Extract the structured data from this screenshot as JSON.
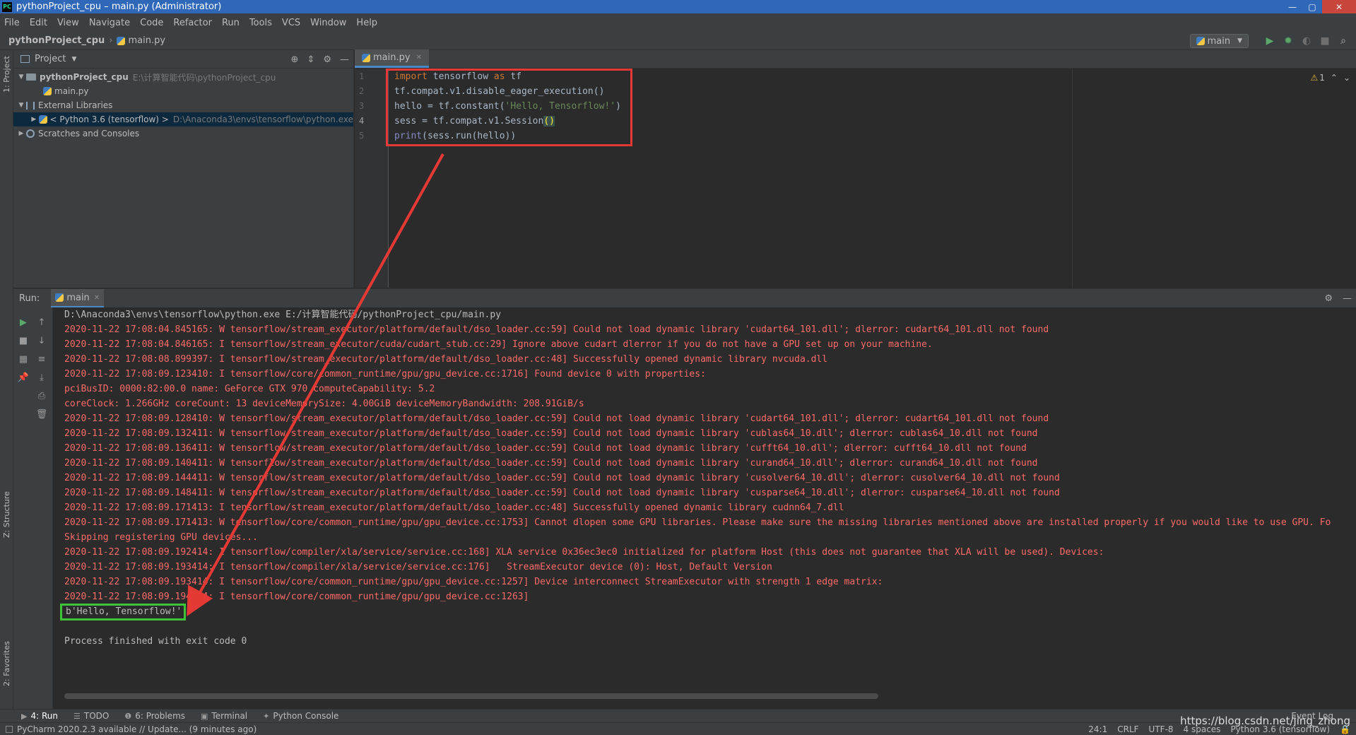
{
  "window": {
    "title": "pythonProject_cpu – main.py (Administrator)",
    "app_icon_text": "PC",
    "minimize": "—",
    "maximize": "▢",
    "close": "✕"
  },
  "menu": [
    "File",
    "Edit",
    "View",
    "Navigate",
    "Code",
    "Refactor",
    "Run",
    "Tools",
    "VCS",
    "Window",
    "Help"
  ],
  "navbar": {
    "project": "pythonProject_cpu",
    "separator": "›",
    "file": "main.py",
    "run_config": "main"
  },
  "left_stripe": {
    "project_label": "1: Project",
    "structure_label": "Z: Structure",
    "favorites_label": "2: Favorites"
  },
  "project_panel": {
    "title": "Project",
    "tree": [
      {
        "label": "pythonProject_cpu",
        "detail": "E:\\计算智能代码\\pythonProject_cpu"
      },
      {
        "label": "main.py",
        "detail": ""
      },
      {
        "label": "External Libraries",
        "detail": ""
      },
      {
        "label": "< Python 3.6 (tensorflow) >",
        "detail": "D:\\Anaconda3\\envs\\tensorflow\\python.exe"
      },
      {
        "label": "Scratches and Consoles",
        "detail": ""
      }
    ]
  },
  "editor": {
    "tab_label": "main.py",
    "line_numbers": [
      "1",
      "2",
      "3",
      "4",
      "5"
    ],
    "inspection": {
      "warning_count": "1"
    },
    "code": {
      "l1_kw": "import",
      "l1_rest": " tensorflow ",
      "l1_as": "as",
      "l1_alias": " tf",
      "l2": "tf.compat.v1.disable_eager_execution()",
      "l3_pre": "hello = tf.constant(",
      "l3_str": "'Hello, Tensorflow!'",
      "l3_post": ")",
      "l4_pre": "sess = tf.compat.v1.Session",
      "l4_paren": "()",
      "l5_fn": "print",
      "l5_rest": "(sess.run(hello))"
    }
  },
  "run_panel": {
    "label": "Run:",
    "tab_label": "main",
    "command": "D:\\Anaconda3\\envs\\tensorflow\\python.exe E:/计算智能代码/pythonProject_cpu/main.py",
    "log_lines": [
      "2020-11-22 17:08:04.845165: W tensorflow/stream_executor/platform/default/dso_loader.cc:59] Could not load dynamic library 'cudart64_101.dll'; dlerror: cudart64_101.dll not found",
      "2020-11-22 17:08:04.846165: I tensorflow/stream_executor/cuda/cudart_stub.cc:29] Ignore above cudart dlerror if you do not have a GPU set up on your machine.",
      "2020-11-22 17:08:08.899397: I tensorflow/stream_executor/platform/default/dso_loader.cc:48] Successfully opened dynamic library nvcuda.dll",
      "2020-11-22 17:08:09.123410: I tensorflow/core/common_runtime/gpu/gpu_device.cc:1716] Found device 0 with properties:",
      "pciBusID: 0000:82:00.0 name: GeForce GTX 970 computeCapability: 5.2",
      "coreClock: 1.266GHz coreCount: 13 deviceMemorySize: 4.00GiB deviceMemoryBandwidth: 208.91GiB/s",
      "2020-11-22 17:08:09.128410: W tensorflow/stream_executor/platform/default/dso_loader.cc:59] Could not load dynamic library 'cudart64_101.dll'; dlerror: cudart64_101.dll not found",
      "2020-11-22 17:08:09.132411: W tensorflow/stream_executor/platform/default/dso_loader.cc:59] Could not load dynamic library 'cublas64_10.dll'; dlerror: cublas64_10.dll not found",
      "2020-11-22 17:08:09.136411: W tensorflow/stream_executor/platform/default/dso_loader.cc:59] Could not load dynamic library 'cufft64_10.dll'; dlerror: cufft64_10.dll not found",
      "2020-11-22 17:08:09.140411: W tensorflow/stream_executor/platform/default/dso_loader.cc:59] Could not load dynamic library 'curand64_10.dll'; dlerror: curand64_10.dll not found",
      "2020-11-22 17:08:09.144411: W tensorflow/stream_executor/platform/default/dso_loader.cc:59] Could not load dynamic library 'cusolver64_10.dll'; dlerror: cusolver64_10.dll not found",
      "2020-11-22 17:08:09.148411: W tensorflow/stream_executor/platform/default/dso_loader.cc:59] Could not load dynamic library 'cusparse64_10.dll'; dlerror: cusparse64_10.dll not found",
      "2020-11-22 17:08:09.171413: I tensorflow/stream_executor/platform/default/dso_loader.cc:48] Successfully opened dynamic library cudnn64_7.dll",
      "2020-11-22 17:08:09.171413: W tensorflow/core/common_runtime/gpu/gpu_device.cc:1753] Cannot dlopen some GPU libraries. Please make sure the missing libraries mentioned above are installed properly if you would like to use GPU. Fo",
      "Skipping registering GPU devices...",
      "2020-11-22 17:08:09.192414: I tensorflow/compiler/xla/service/service.cc:168] XLA service 0x36ec3ec0 initialized for platform Host (this does not guarantee that XLA will be used). Devices:",
      "2020-11-22 17:08:09.193414: I tensorflow/compiler/xla/service/service.cc:176]   StreamExecutor device (0): Host, Default Version",
      "2020-11-22 17:08:09.193414: I tensorflow/core/common_runtime/gpu/gpu_device.cc:1257] Device interconnect StreamExecutor with strength 1 edge matrix:",
      "2020-11-22 17:08:09.194414: I tensorflow/core/common_runtime/gpu/gpu_device.cc:1263]"
    ],
    "result": "b'Hello, Tensorflow!'",
    "exit": "Process finished with exit code 0"
  },
  "bottom_tools": [
    {
      "icon": "▶",
      "label": "4: Run"
    },
    {
      "icon": "☰",
      "label": "TODO"
    },
    {
      "icon": "❶",
      "label": "6: Problems"
    },
    {
      "icon": "▣",
      "label": "Terminal"
    },
    {
      "icon": "✦",
      "label": "Python Console"
    }
  ],
  "event_log": "Event Log",
  "status": {
    "message": "PyCharm 2020.2.3 available // Update... (9 minutes ago)",
    "position": "24:1",
    "line_sep": "CRLF",
    "encoding": "UTF-8",
    "indent": "4 spaces",
    "interpreter": "Python 3.6 (tensorflow)"
  },
  "watermark": "https://blog.csdn.net/jing_zhong",
  "colors": {
    "annotation_red": "#e53935",
    "annotation_green": "#3ec43a",
    "log_red": "#ff6b68"
  }
}
